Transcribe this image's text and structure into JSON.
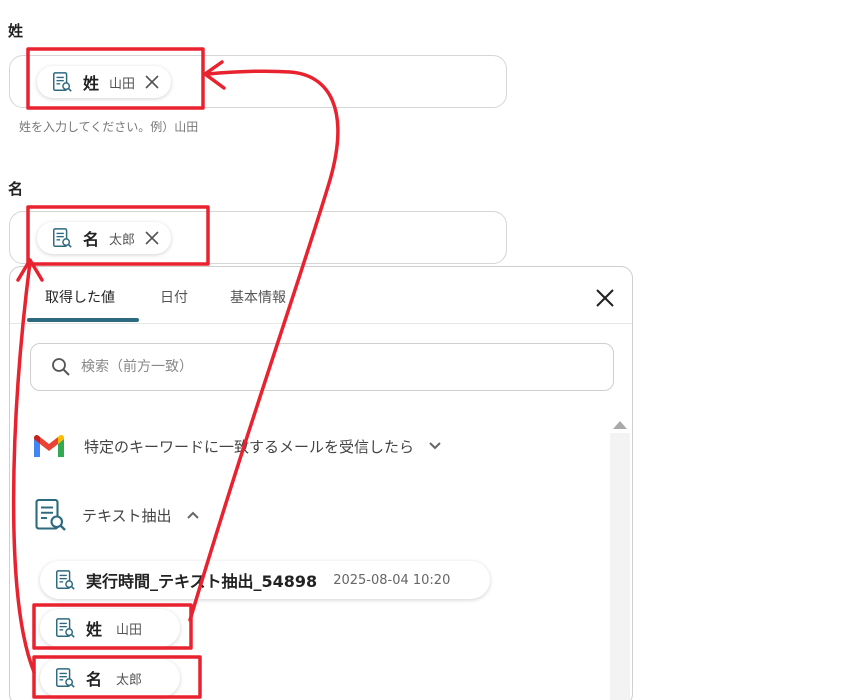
{
  "fields": {
    "sei": {
      "label": "姓",
      "chip_name": "姓",
      "chip_value": "山田",
      "helper": "姓を入力してください。例）山田"
    },
    "mei": {
      "label": "名",
      "chip_name": "名",
      "chip_value": "太郎"
    }
  },
  "panel": {
    "tabs": [
      {
        "label": "取得した値"
      },
      {
        "label": "日付"
      },
      {
        "label": "基本情報"
      }
    ],
    "search_placeholder": "検索（前方一致）",
    "groups": [
      {
        "title": "特定のキーワードに一致するメールを受信したら",
        "icon": "gmail-icon",
        "expanded": false
      },
      {
        "title": "テキスト抽出",
        "icon": "document-search-icon",
        "expanded": true
      }
    ],
    "items": [
      {
        "name": "実行時間_テキスト抽出_54898",
        "value": "2025-08-04 10:20"
      },
      {
        "name": "姓",
        "value": "山田"
      },
      {
        "name": "名",
        "value": "太郎"
      }
    ]
  },
  "colors": {
    "accent": "#2d6a7f",
    "annotation": "#e8222e",
    "gmail_red": "#ea4335",
    "gmail_blue": "#4285f4",
    "gmail_green": "#34a853",
    "gmail_yellow": "#fbbc05"
  }
}
